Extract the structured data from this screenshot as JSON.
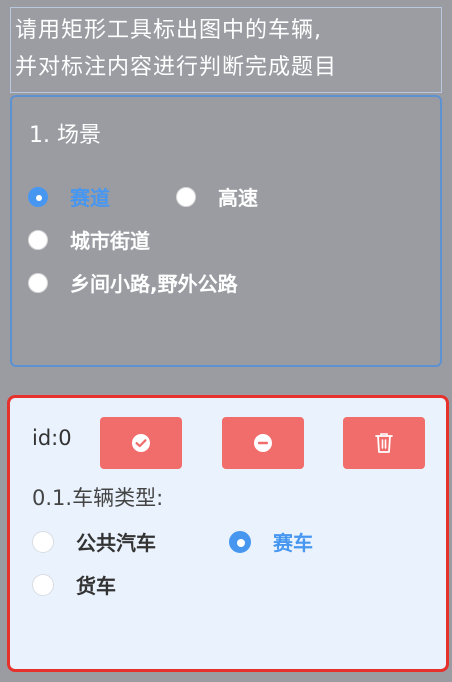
{
  "instruction": {
    "line1": "请用矩形工具标出图中的车辆,",
    "line2": "并对标注内容进行判断完成题目"
  },
  "scene_question": {
    "title": "1. 场景",
    "options": [
      {
        "label": "赛道",
        "selected": true
      },
      {
        "label": "高速",
        "selected": false
      },
      {
        "label": "城市街道",
        "selected": false
      },
      {
        "label": "乡间小路,野外公路",
        "selected": false
      }
    ]
  },
  "annotation": {
    "id_label": "id:0",
    "buttons": {
      "confirm_icon": "check-circle-icon",
      "remove_icon": "minus-circle-icon",
      "delete_icon": "trash-icon"
    },
    "question_title": "0.1.车辆类型:",
    "options": [
      {
        "label": "公共汽车",
        "selected": false
      },
      {
        "label": "赛车",
        "selected": true
      },
      {
        "label": "货车",
        "selected": false
      }
    ]
  },
  "colors": {
    "accent": "#4797f1",
    "button": "#f06d6b",
    "highlight_border": "#e6312c"
  }
}
